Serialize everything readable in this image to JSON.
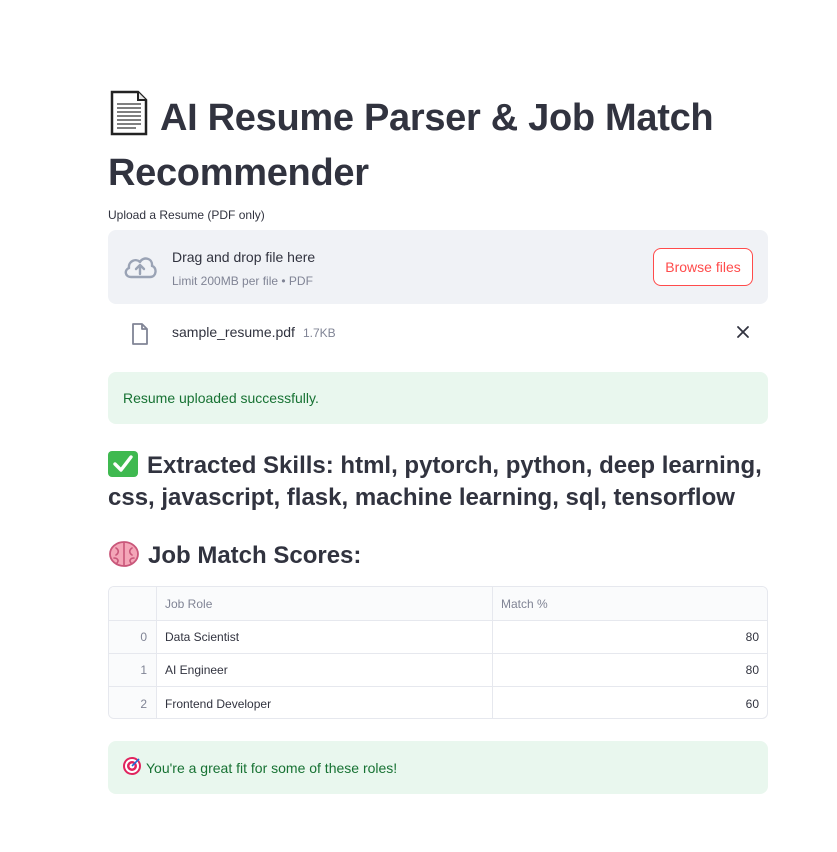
{
  "page": {
    "title": "AI Resume Parser & Job Match Recommender",
    "title_icon": "document-icon"
  },
  "uploader": {
    "label": "Upload a Resume (PDF only)",
    "drop_title": "Drag and drop file here",
    "drop_subtitle": "Limit 200MB per file • PDF",
    "browse_label": "Browse files",
    "file": {
      "name": "sample_resume.pdf",
      "size": "1.7KB"
    }
  },
  "upload_status": "Resume uploaded successfully.",
  "skills": {
    "heading": "Extracted Skills: html, pytorch, python, deep learning, css, javascript, flask, machine learning, sql, tensorflow"
  },
  "scores": {
    "heading": "Job Match Scores:",
    "columns": [
      "",
      "Job Role",
      "Match %"
    ],
    "rows": [
      {
        "index": "0",
        "role": "Data Scientist",
        "match": "80"
      },
      {
        "index": "1",
        "role": "AI Engineer",
        "match": "80"
      },
      {
        "index": "2",
        "role": "Frontend Developer",
        "match": "60"
      }
    ]
  },
  "result_message": "You're a great fit for some of these roles!",
  "colors": {
    "accent": "#ff4b4b",
    "success_bg": "#e9f7ee",
    "success_text": "#177233",
    "dropzone_bg": "#f0f2f6",
    "text": "#31333f",
    "muted": "#808495"
  }
}
